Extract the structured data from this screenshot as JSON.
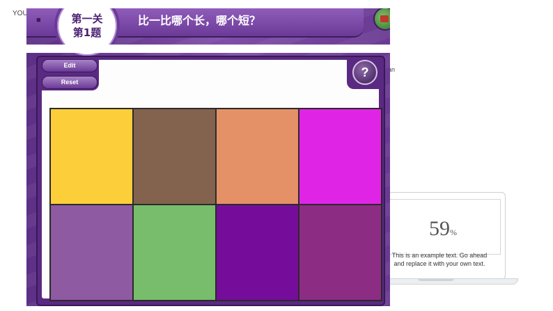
{
  "background": {
    "label_you": "YOU",
    "fragment_an": "an"
  },
  "app": {
    "title": "比一比哪个长，哪个短？",
    "level": {
      "line1": "第一关",
      "line2": "第1题"
    },
    "icons": {
      "home": "house-icon",
      "globe": "globe-icon"
    },
    "buttons": {
      "edit": "Edit",
      "reset": "Reset",
      "help": "?"
    },
    "colors": {
      "frame": "#5a2a82",
      "cells": [
        "#fcce3a",
        "#83634e",
        "#e49168",
        "#e024e5",
        "#8e5aa2",
        "#77bd6c",
        "#750d9a",
        "#8d2c83"
      ]
    }
  },
  "sidebar_card": {
    "percent_value": "59",
    "percent_unit": "%",
    "text": "This is an example text. Go ahead and replace it with your own text."
  }
}
